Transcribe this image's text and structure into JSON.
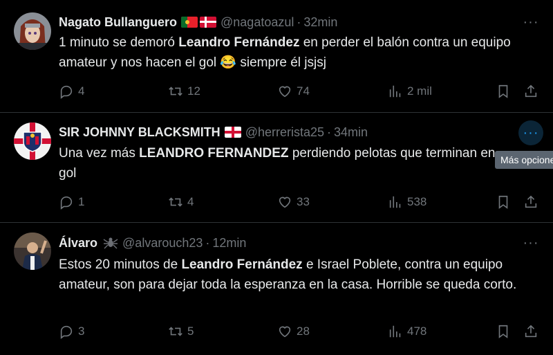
{
  "tweets": [
    {
      "name": "Nagato Bullanguero",
      "handle": "@nagatoazul",
      "separator": "·",
      "time": "32min",
      "text": [
        {
          "t": "1 minuto se demoró ",
          "b": false
        },
        {
          "t": "Leandro Fernández",
          "b": true
        },
        {
          "t": " en perder el balón contra un equipo amateur y nos hacen el gol ",
          "b": false
        },
        {
          "t": "😂",
          "b": false
        },
        {
          "t": " siempre él jsjsj",
          "b": false
        }
      ],
      "replies": "4",
      "retweets": "12",
      "likes": "74",
      "views": "2 mil",
      "flags": [
        "portugal",
        "denmark"
      ],
      "avatar_icon": "masked-ninja-avatar"
    },
    {
      "name": "SIR JOHNNY BLACKSMITH",
      "handle": "@herrerista25",
      "separator": "·",
      "time": "34min",
      "text": [
        {
          "t": "Una vez más ",
          "b": false
        },
        {
          "t": "LEANDRO FERNANDEZ",
          "b": true
        },
        {
          "t": " perdiendo pelotas que terminan en gol",
          "b": false
        }
      ],
      "replies": "1",
      "retweets": "4",
      "likes": "33",
      "views": "538",
      "flags": [
        "england"
      ],
      "avatar_icon": "club-crest-avatar"
    },
    {
      "name": "Álvaro",
      "handle": "@alvarouch23",
      "separator": "·",
      "time": "12min",
      "text": [
        {
          "t": "Estos 20 minutos de ",
          "b": false
        },
        {
          "t": "Leandro Fernández",
          "b": true
        },
        {
          "t": " e Israel Poblete, contra un equipo amateur, son para dejar toda la esperanza en la casa. Horrible se queda corto.",
          "b": false
        }
      ],
      "replies": "3",
      "retweets": "5",
      "likes": "28",
      "views": "478",
      "flags": [
        "spider"
      ],
      "avatar_icon": "person-photo-avatar"
    }
  ],
  "more_glyph": "···",
  "tooltip": "Más opciones",
  "colors": {
    "background": "#000000",
    "text": "#e7e9ea",
    "muted": "#71767b",
    "accent": "#1d9bf0",
    "divider": "#2f3336"
  }
}
